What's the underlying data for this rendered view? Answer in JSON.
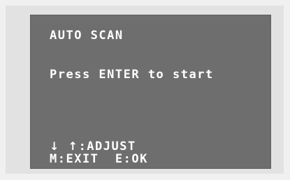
{
  "osd": {
    "title": "AUTO SCAN",
    "prompt": "Press ENTER to start",
    "hints": {
      "adjust_arrow_down": "↓",
      "adjust_arrow_up": "↑",
      "adjust_label": ":ADJUST",
      "menu_exit": "M:EXIT",
      "enter_ok": "E:OK"
    }
  },
  "colors": {
    "background": "#f0f0f0",
    "frame": "#e2e2e2",
    "screen": "#6e6e6e",
    "text": "#ffffff"
  }
}
